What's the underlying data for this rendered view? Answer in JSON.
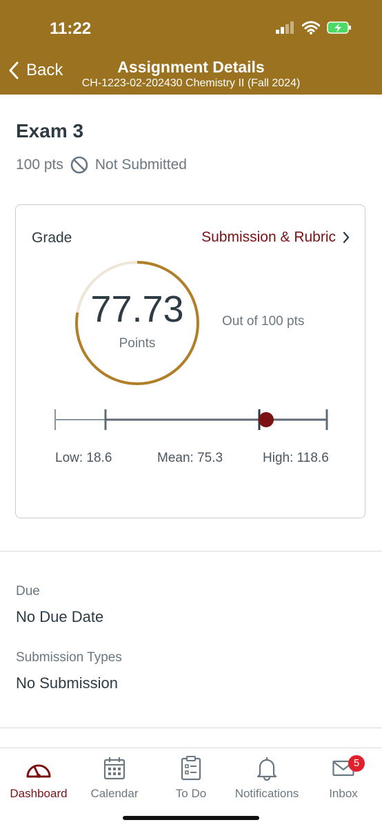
{
  "status": {
    "time": "11:22"
  },
  "nav": {
    "back_label": "Back",
    "title": "Assignment Details",
    "subtitle": "CH-1223-02-202430 Chemistry II (Fall 2024)"
  },
  "assignment": {
    "title": "Exam 3",
    "points": "100 pts",
    "submission_status": "Not Submitted"
  },
  "grade": {
    "label": "Grade",
    "rubric_link": "Submission & Rubric",
    "score": "77.73",
    "score_unit": "Points",
    "out_of": "Out of 100 pts",
    "score_fraction": 0.7773,
    "low_label": "Low: 18.6",
    "mean_label": "Mean: 75.3",
    "high_label": "High: 118.6"
  },
  "details": {
    "due_label": "Due",
    "due_value": "No Due Date",
    "submission_types_label": "Submission Types",
    "submission_types_value": "No Submission"
  },
  "tabbar": {
    "tabs": [
      {
        "label": "Dashboard",
        "icon": "dashboard-gauge-icon",
        "active": true
      },
      {
        "label": "Calendar",
        "icon": "calendar-icon"
      },
      {
        "label": "To Do",
        "icon": "clipboard-icon"
      },
      {
        "label": "Notifications",
        "icon": "bell-icon"
      },
      {
        "label": "Inbox",
        "icon": "envelope-icon"
      }
    ],
    "inbox_badge": "5"
  },
  "colors": {
    "header": "#9a7220",
    "accent": "#7a1214",
    "ring": "#b07f28",
    "ring_track": "#eee6d8"
  }
}
